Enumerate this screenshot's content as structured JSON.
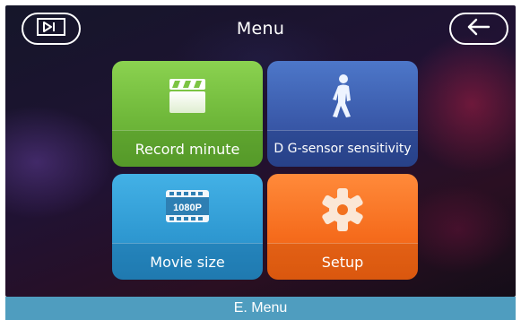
{
  "header": {
    "title": "Menu",
    "left_button_icon": "playback-frame-icon",
    "right_button_icon": "back-arrow-icon"
  },
  "tiles": [
    {
      "label": "Record minute",
      "icon": "clapperboard-icon",
      "color": "#7cc443"
    },
    {
      "label": "D G-sensor sensitivity",
      "icon": "walking-person-icon",
      "color": "#4166b8"
    },
    {
      "label": "Movie size",
      "icon": "film-1080p-icon",
      "badge": "1080P",
      "color": "#34a3dc"
    },
    {
      "label": "Setup",
      "icon": "gear-icon",
      "color": "#f77624"
    }
  ],
  "caption": "E. Menu"
}
